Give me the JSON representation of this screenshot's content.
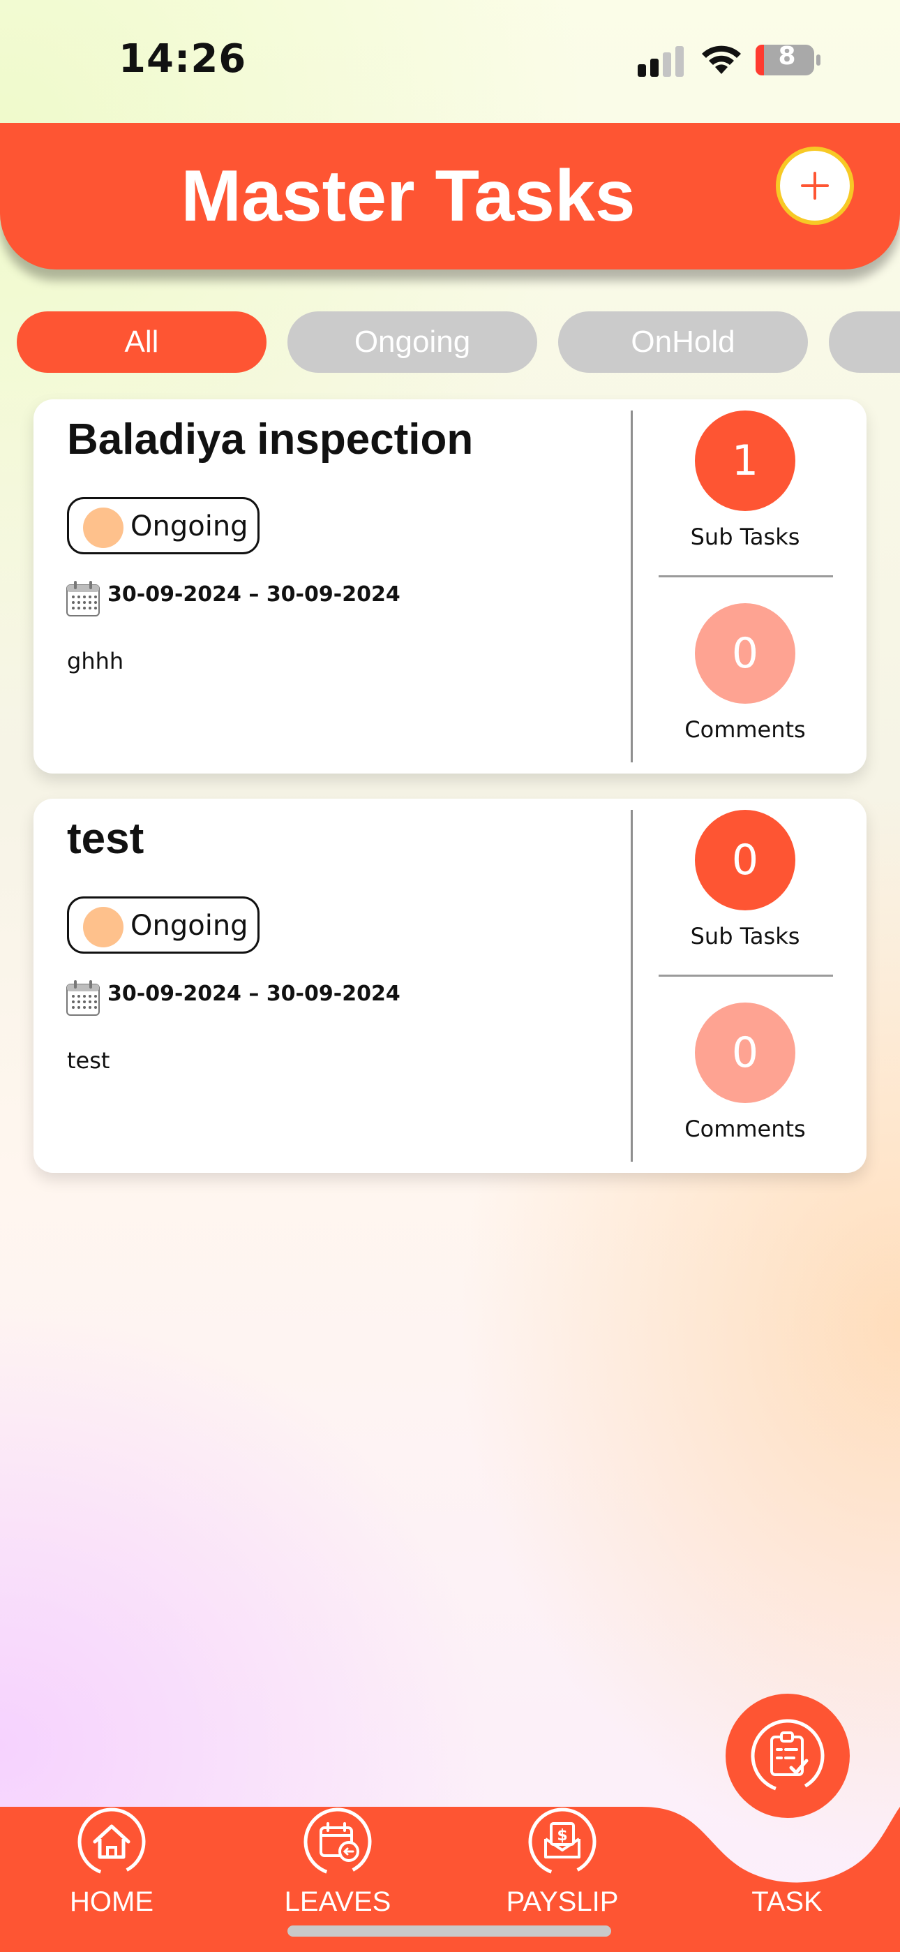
{
  "status_bar": {
    "time": "14:26",
    "battery": "8"
  },
  "header": {
    "title": "Master Tasks"
  },
  "filters": [
    {
      "label": "All",
      "active": true
    },
    {
      "label": "Ongoing",
      "active": false
    },
    {
      "label": "OnHold",
      "active": false
    },
    {
      "label": "",
      "active": false
    }
  ],
  "tasks": [
    {
      "title": "Baladiya inspection",
      "status": "Ongoing",
      "start_date": "30-09-2024",
      "end_date": "30-09-2024",
      "date_separator": "–",
      "description": "ghhh",
      "sub_tasks_count": "1",
      "sub_tasks_label": "Sub Tasks",
      "comments_count": "0",
      "comments_label": "Comments"
    },
    {
      "title": "test",
      "status": "Ongoing",
      "start_date": "30-09-2024",
      "end_date": "30-09-2024",
      "date_separator": "–",
      "description": "test",
      "sub_tasks_count": "0",
      "sub_tasks_label": "Sub Tasks",
      "comments_count": "0",
      "comments_label": "Comments"
    }
  ],
  "nav": {
    "home": "HOME",
    "leaves": "LEAVES",
    "payslip": "PAYSLIP",
    "task": "TASK"
  },
  "icons": [
    "signal-icon",
    "wifi-icon",
    "battery-icon",
    "plus-icon",
    "calendar-icon",
    "home-icon",
    "leaves-icon",
    "payslip-icon",
    "task-icon"
  ],
  "colors": {
    "accent": "#fe5533",
    "comments": "#fea392",
    "status_dot": "#fec18c",
    "pill_inactive": "#cbcbcb",
    "fab_ring": "#f7c925"
  }
}
